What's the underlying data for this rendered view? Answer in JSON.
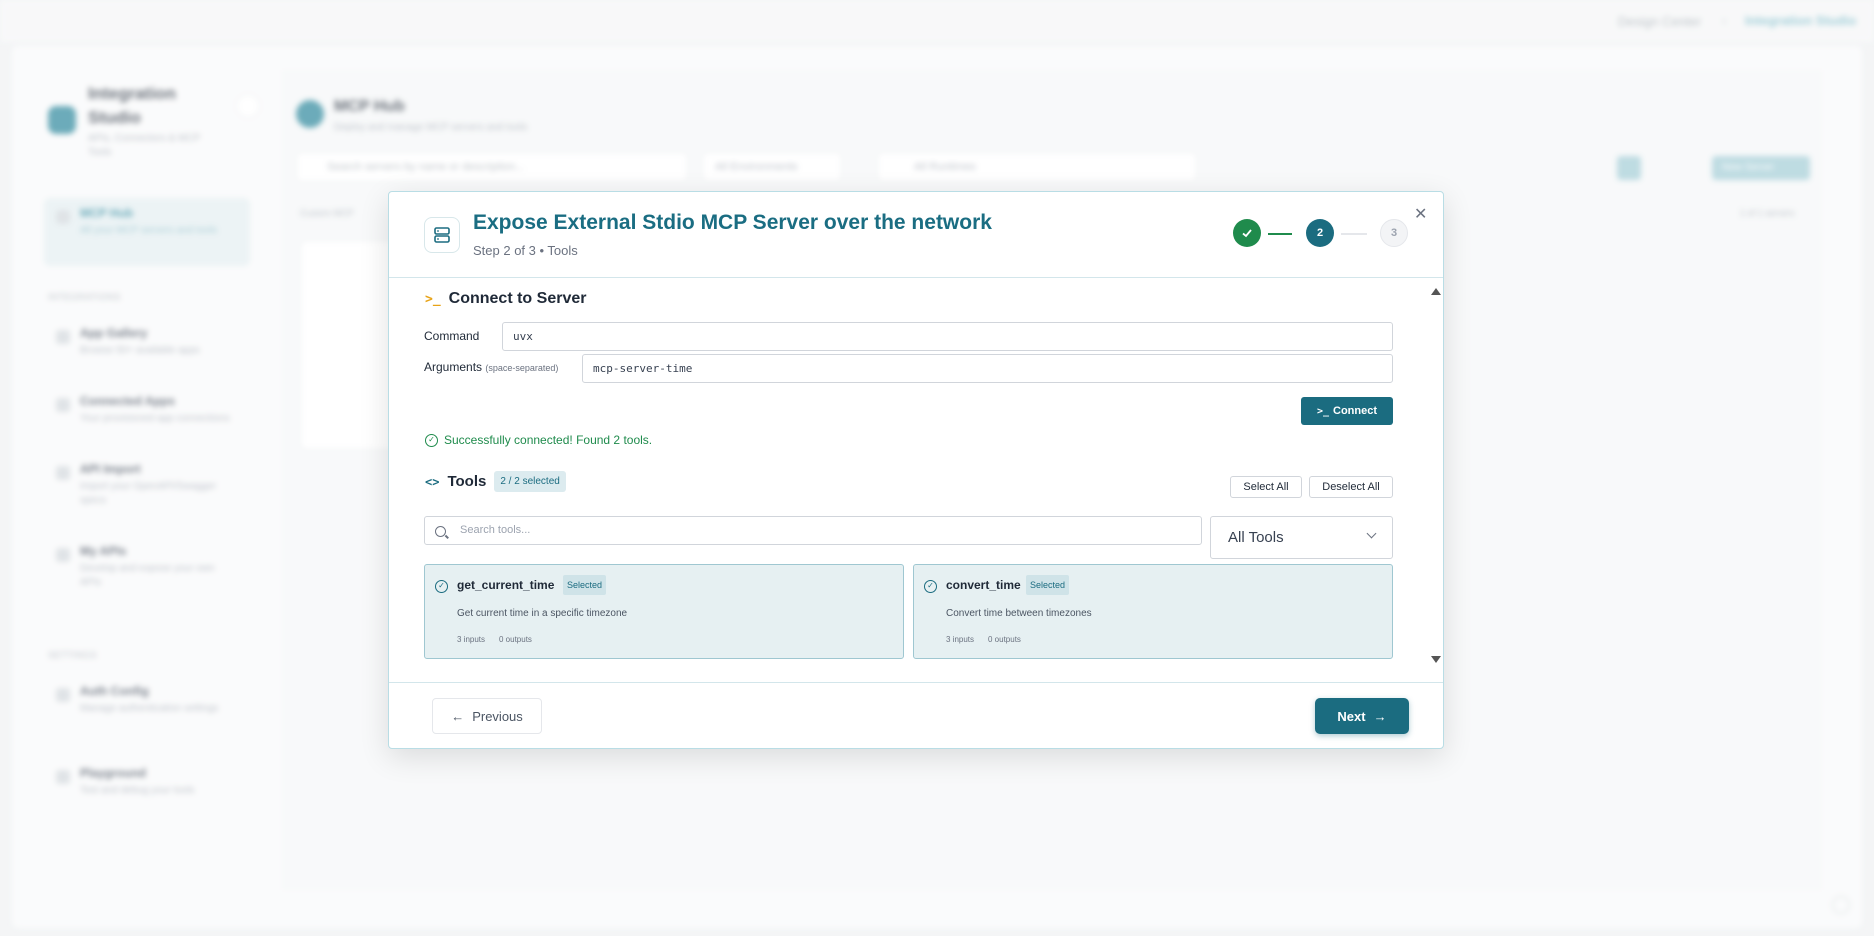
{
  "background": {
    "breadcrumb": {
      "first": "Design Center",
      "current": "Integration Studio"
    },
    "sidebar": {
      "title": "Integration Studio",
      "subtitle": "APIs, Connectors & MCP Tools",
      "active_item": {
        "label": "MCP Hub",
        "desc": "All your MCP servers and tools"
      },
      "section_integrations": "INTEGRATIONS",
      "items": [
        {
          "label": "App Gallery",
          "desc": "Browse 50+ available apps"
        },
        {
          "label": "Connected Apps",
          "desc": "Your provisioned app connections"
        },
        {
          "label": "API Import",
          "desc": "Import your OpenAPI/Swagger specs"
        },
        {
          "label": "My APIs",
          "desc": "Develop and expose your own APIs"
        }
      ],
      "section_settings": "SETTINGS",
      "settings_items": [
        {
          "label": "Auth Config",
          "desc": "Manage authentication settings"
        },
        {
          "label": "Playground",
          "desc": "Test and debug your tools"
        }
      ]
    },
    "main": {
      "title": "MCP Hub",
      "subtitle": "Deploy and manage MCP servers and tools",
      "search_placeholder": "Search servers by name or description...",
      "env_filter": "All Environments",
      "runtime_filter": "All Runtimes",
      "custom_label": "Custom MCP",
      "count_label": "1 of 1 servers",
      "new_server_label": "New Server"
    }
  },
  "modal": {
    "title": "Expose External Stdio MCP Server over the network",
    "step_text": "Step 2 of 3 • Tools",
    "steps": {
      "current": "2",
      "next": "3"
    },
    "connect": {
      "section_title": "Connect to Server",
      "command_label": "Command",
      "command_value": "uvx",
      "args_label": "Arguments",
      "args_hint": "(space-separated)",
      "args_value": "mcp-server-time",
      "connect_button": "Connect",
      "success": "Successfully connected! Found 2 tools."
    },
    "tools": {
      "title": "Tools",
      "badge": "2 / 2 selected",
      "select_all": "Select All",
      "deselect_all": "Deselect All",
      "search_placeholder": "Search tools...",
      "filter": "All Tools",
      "items": [
        {
          "name": "get_current_time",
          "status": "Selected",
          "desc": "Get current time in a specific timezone",
          "inputs": "3 inputs",
          "outputs": "0 outputs"
        },
        {
          "name": "convert_time",
          "status": "Selected",
          "desc": "Convert time between timezones",
          "inputs": "3 inputs",
          "outputs": "0 outputs"
        }
      ]
    },
    "footer": {
      "previous": "Previous",
      "next": "Next"
    }
  }
}
